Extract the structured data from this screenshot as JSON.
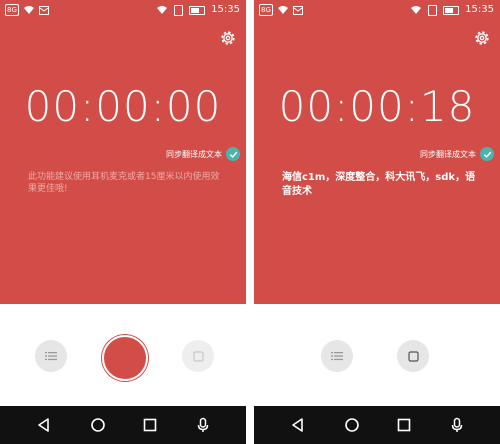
{
  "left": {
    "status": {
      "badge": "8G",
      "time": "15:35"
    },
    "timer": "00:00:00",
    "sync_label": "同步翻译成文本",
    "hint": "此功能建议使用耳机麦克或者15厘米以内使用效果更佳哦!"
  },
  "right": {
    "status": {
      "badge": "8G",
      "time": "15:35"
    },
    "timer": "00:00:18",
    "sync_label": "同步翻译成文本",
    "transcript": "海信c1m，深度整合，科大讯飞，sdk，语音技术"
  },
  "colors": {
    "accent": "#d24d48",
    "check": "#4bb4ad",
    "navbar": "#111111"
  },
  "icons": [
    "settings-icon",
    "check-icon",
    "list-icon",
    "stop-icon",
    "back-icon",
    "home-icon",
    "recents-icon",
    "mic-icon"
  ]
}
